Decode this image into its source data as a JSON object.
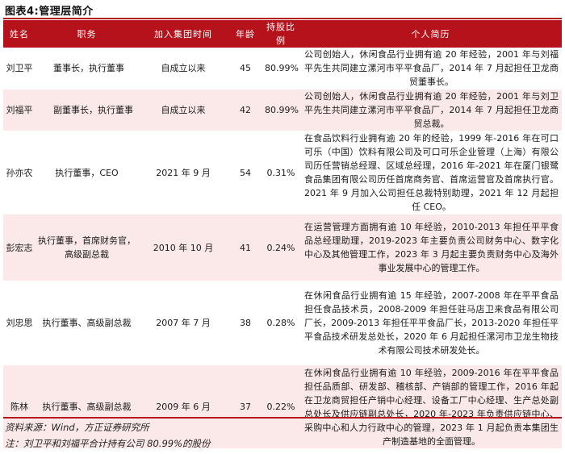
{
  "figure_title": "图表4:管理层简介",
  "table": {
    "headers": [
      "姓名",
      "职务",
      "加入集团时间",
      "年龄",
      "持股比例",
      "个人简历"
    ],
    "rows": [
      {
        "name": "刘卫平",
        "role": "董事长，执行董事",
        "joined": "自成立以来",
        "age": "45",
        "share": "80.99%",
        "bio": "公司创始人，休闲食品行业拥有逾 20 年经验，2001 年与刘福平先生共同建立漯河市平平食品厂，2014 年 7 月起担任卫龙商贸董事长。"
      },
      {
        "name": "刘福平",
        "role": "副董事长，执行董事",
        "joined": "自成立以来",
        "age": "42",
        "share": "80.99%",
        "bio": "公司创始人，休闲食品行业拥有逾 20 年经验，2001 年与刘卫平先生共同建立漯河市平平食品厂，2014 年 7 月起担任卫龙商贸总裁。"
      },
      {
        "name": "孙亦农",
        "role": "执行董事，CEO",
        "joined": "2021 年 9 月",
        "age": "54",
        "share": "0.31%",
        "bio": "在食品饮料行业拥有逾 20 年的经验，1999 年-2016 年在可口可乐（中国）饮料有限公司及可口可乐企业管理（上海）有限公司历任营销总经理、区域总经理，2016 年-2021 年在厦门银鹭食品集团有限公司历任首席商务官、首席运营官及首席执行官。2021 年 9 月加入公司担任总裁特别助理，2021 年 12 月起担任 CEO。"
      },
      {
        "name": "彭宏志",
        "role": "执行董事，首席财务官，高级副总裁",
        "joined": "2010 年 10 月",
        "age": "41",
        "share": "0.24%",
        "bio": "在运营管理方面拥有逾 10 年经验，2010-2013 年担任平平食品总经理助理，2019-2023 年主要负责公司财务中心、数字化中心及其他管理工作，2023 年 3 月起主要负责财务中心及海外事业发展中心的管理工作。"
      },
      {
        "name": "刘忠思",
        "role": "执行董事、高级副总裁",
        "joined": "2007 年 7 月",
        "age": "38",
        "share": "0.28%",
        "bio": "在休闲食品行业拥有逾 15 年经验，2007-2008 年在平平食品担任食品技术员，2008-2009 年担任驻马店卫来食品有限公司厂长，2009-2013 年担任平平食品厂长，2013-2020 年担任平平食品技术研发总处长，2020 年 6 月起担任漯河市卫龙生物技术有限公司技术研发处长。"
      },
      {
        "name": "陈林",
        "role": "执行董事、高级副总裁",
        "joined": "2009 年 6 月",
        "age": "37",
        "share": "0.22%",
        "bio": "在休闲食品行业拥有逾 10 年经验，2009-2016 年在平平食品担任品质部、研发部、稽核部、产销部的管理工作，2016 年起在卫龙商贸担任产销中心经理、设备工厂中心经理、生产总处副总处长及供应链副总处长，2020 年-2023 年负责供应链中心、采购中心和人力行政中心的管理，2023 年 1 月起负责本集团生产制造基地的全面管理。"
      }
    ]
  },
  "footer": {
    "source": "资料来源：Wind，方正证券研究所",
    "note": "注：刘卫平和刘福平合计持有公司 80.99%的股份"
  },
  "colors": {
    "header_bg": "#b5121b",
    "stripe_bg": "#fbe9e9"
  }
}
